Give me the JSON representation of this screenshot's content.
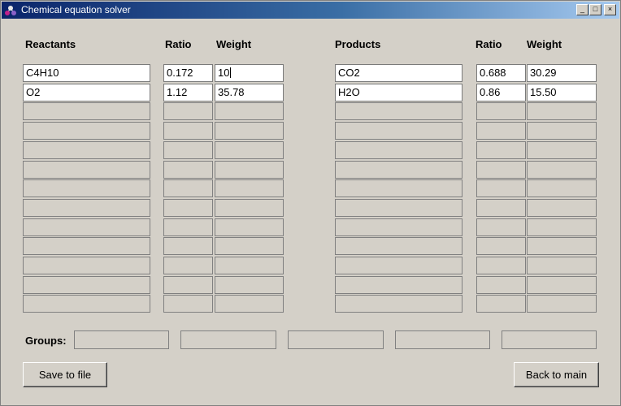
{
  "window": {
    "title": "Chemical equation solver",
    "minimize": "_",
    "maximize": "□",
    "close": "×"
  },
  "reactants": {
    "header_name": "Reactants",
    "header_ratio": "Ratio",
    "header_weight": "Weight",
    "rows": [
      {
        "name": "C4H10",
        "ratio": "0.172",
        "weight": "10"
      },
      {
        "name": "O2",
        "ratio": "1.12",
        "weight": "35.78"
      },
      {
        "name": "",
        "ratio": "",
        "weight": ""
      },
      {
        "name": "",
        "ratio": "",
        "weight": ""
      },
      {
        "name": "",
        "ratio": "",
        "weight": ""
      },
      {
        "name": "",
        "ratio": "",
        "weight": ""
      },
      {
        "name": "",
        "ratio": "",
        "weight": ""
      },
      {
        "name": "",
        "ratio": "",
        "weight": ""
      },
      {
        "name": "",
        "ratio": "",
        "weight": ""
      },
      {
        "name": "",
        "ratio": "",
        "weight": ""
      },
      {
        "name": "",
        "ratio": "",
        "weight": ""
      },
      {
        "name": "",
        "ratio": "",
        "weight": ""
      },
      {
        "name": "",
        "ratio": "",
        "weight": ""
      }
    ]
  },
  "products": {
    "header_name": "Products",
    "header_ratio": "Ratio",
    "header_weight": "Weight",
    "rows": [
      {
        "name": "CO2",
        "ratio": "0.688",
        "weight": "30.29"
      },
      {
        "name": "H2O",
        "ratio": "0.86",
        "weight": "15.50"
      },
      {
        "name": "",
        "ratio": "",
        "weight": ""
      },
      {
        "name": "",
        "ratio": "",
        "weight": ""
      },
      {
        "name": "",
        "ratio": "",
        "weight": ""
      },
      {
        "name": "",
        "ratio": "",
        "weight": ""
      },
      {
        "name": "",
        "ratio": "",
        "weight": ""
      },
      {
        "name": "",
        "ratio": "",
        "weight": ""
      },
      {
        "name": "",
        "ratio": "",
        "weight": ""
      },
      {
        "name": "",
        "ratio": "",
        "weight": ""
      },
      {
        "name": "",
        "ratio": "",
        "weight": ""
      },
      {
        "name": "",
        "ratio": "",
        "weight": ""
      },
      {
        "name": "",
        "ratio": "",
        "weight": ""
      }
    ]
  },
  "groups": {
    "label": "Groups:",
    "values": [
      "",
      "",
      "",
      "",
      ""
    ]
  },
  "buttons": {
    "save": "Save to file",
    "back": "Back to main"
  }
}
